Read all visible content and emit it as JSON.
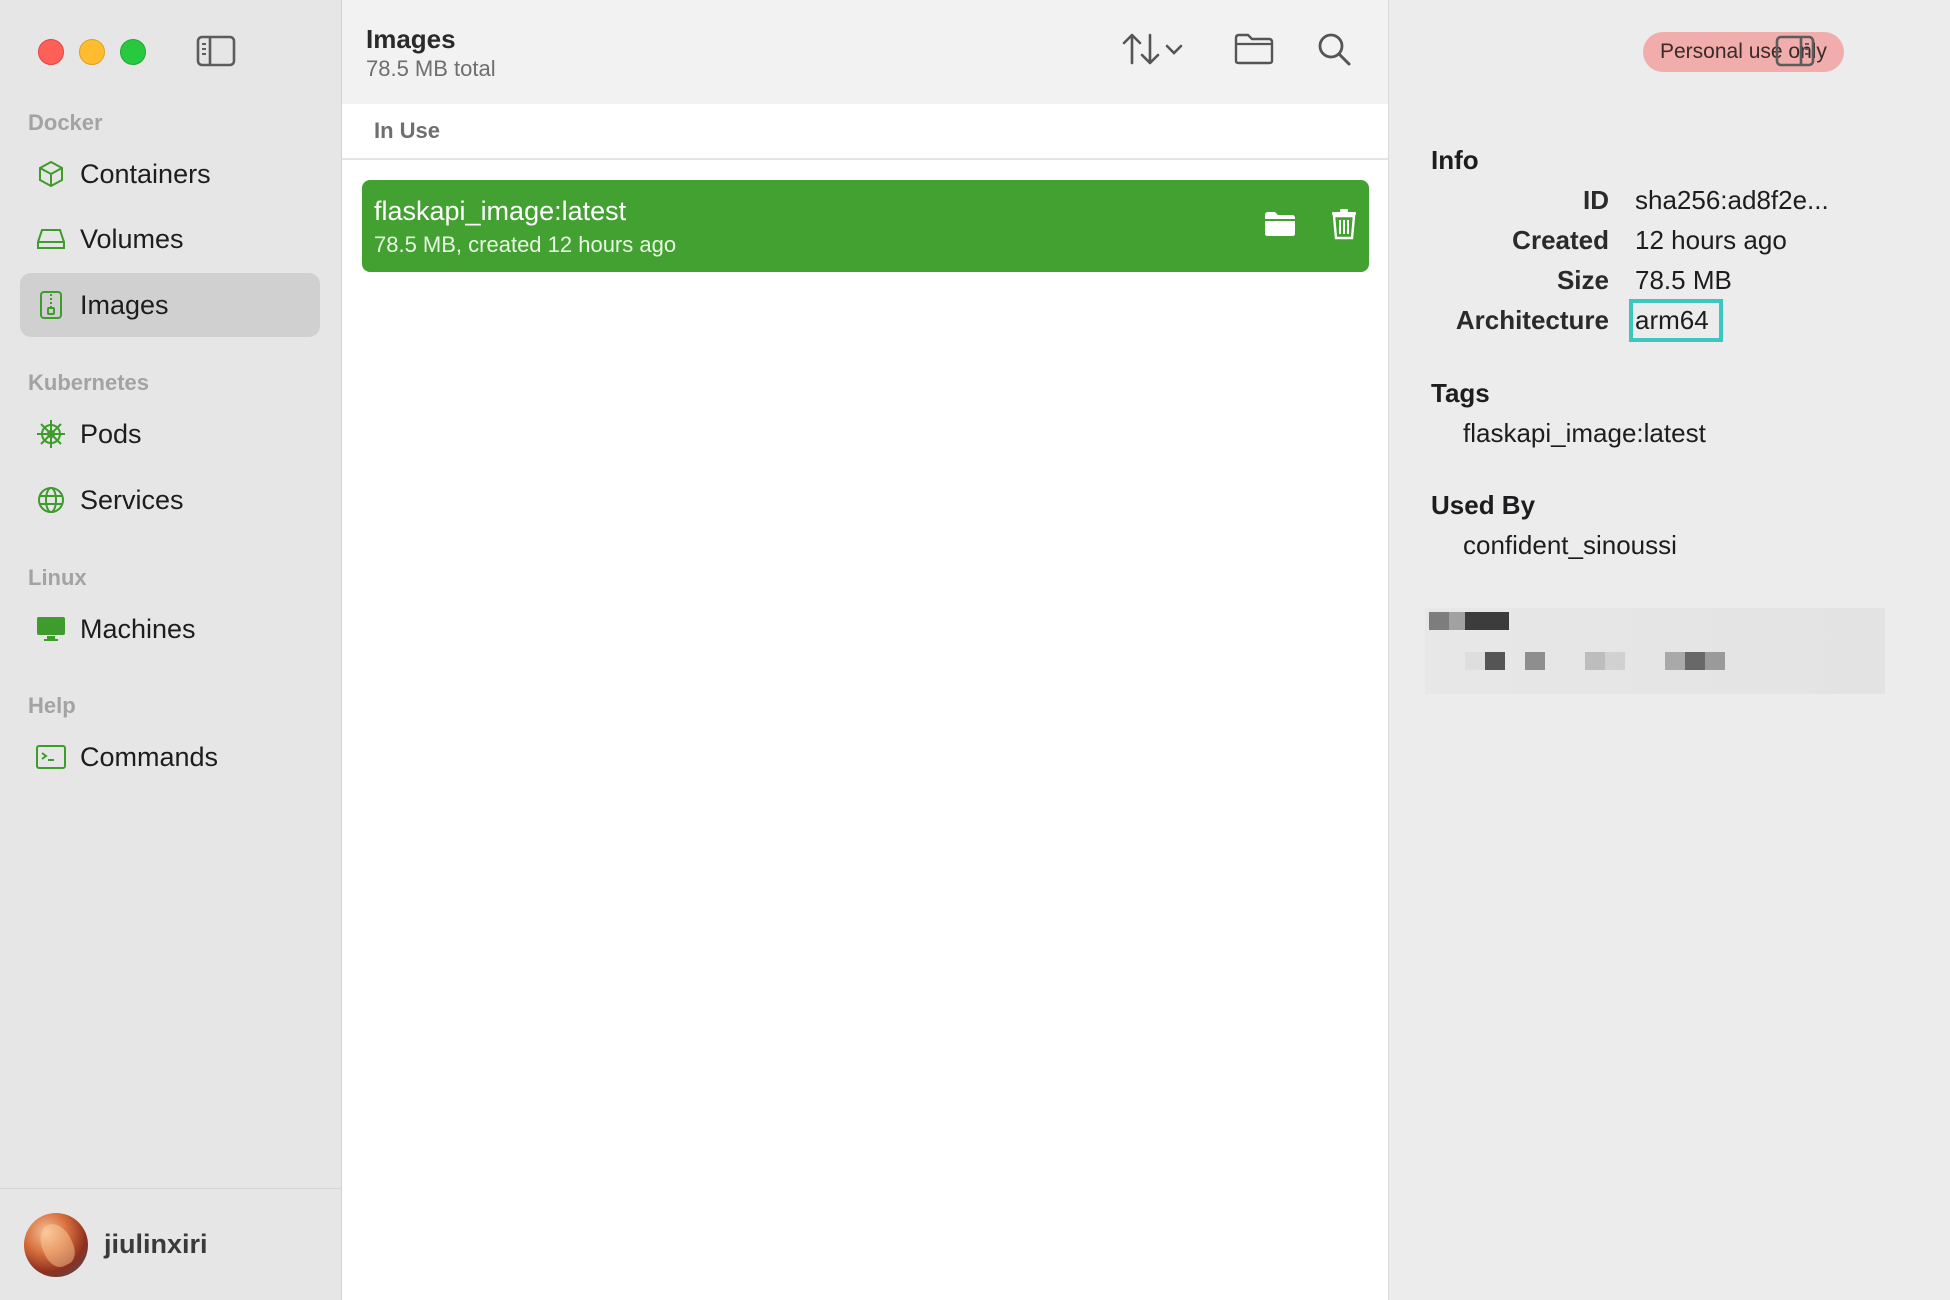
{
  "sidebar": {
    "sections": [
      {
        "label": "Docker",
        "items": [
          {
            "label": "Containers",
            "icon": "cube-icon"
          },
          {
            "label": "Volumes",
            "icon": "drive-icon"
          },
          {
            "label": "Images",
            "icon": "archive-icon",
            "active": true
          }
        ]
      },
      {
        "label": "Kubernetes",
        "items": [
          {
            "label": "Pods",
            "icon": "helm-wheel-icon"
          },
          {
            "label": "Services",
            "icon": "globe-icon"
          }
        ]
      },
      {
        "label": "Linux",
        "items": [
          {
            "label": "Machines",
            "icon": "monitor-icon"
          }
        ]
      },
      {
        "label": "Help",
        "items": [
          {
            "label": "Commands",
            "icon": "terminal-icon"
          }
        ]
      }
    ],
    "user": {
      "name": "jiulinxiri"
    }
  },
  "list": {
    "title": "Images",
    "subtitle": "78.5 MB total",
    "group": "In Use",
    "items": [
      {
        "name": "flaskapi_image:latest",
        "meta": "78.5 MB, created 12 hours ago"
      }
    ]
  },
  "inspector": {
    "badge": "Personal use only",
    "info_title": "Info",
    "info": [
      {
        "key": "ID",
        "value": "sha256:ad8f2e..."
      },
      {
        "key": "Created",
        "value": "12 hours ago"
      },
      {
        "key": "Size",
        "value": "78.5 MB"
      },
      {
        "key": "Architecture",
        "value": "arm64"
      }
    ],
    "tags_title": "Tags",
    "tags": [
      "flaskapi_image:latest"
    ],
    "used_by_title": "Used By",
    "used_by": [
      "confident_sinoussi"
    ]
  },
  "colors": {
    "accent_green": "#42a130",
    "badge_pink": "#f0adab",
    "highlight_teal": "#3cc6c0"
  }
}
